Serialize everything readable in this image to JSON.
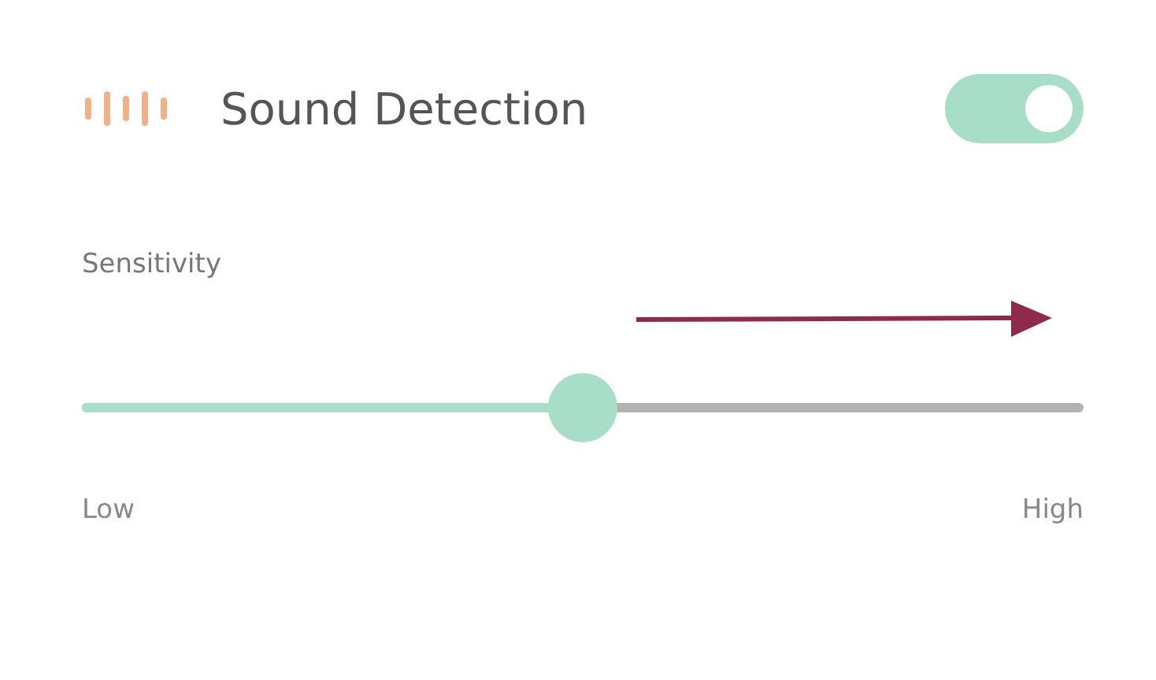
{
  "header": {
    "title": "Sound Detection",
    "toggle": {
      "on": true
    }
  },
  "slider": {
    "label": "Sensitivity",
    "level": 0.5,
    "min_label": "Low",
    "max_label": "High"
  }
}
